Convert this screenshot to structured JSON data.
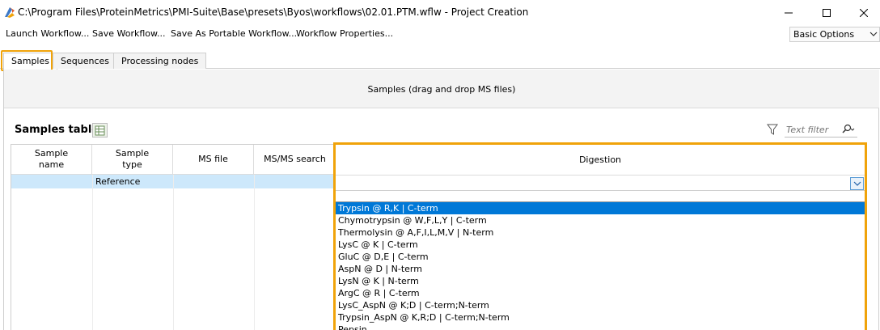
{
  "window": {
    "title": "C:\\Program Files\\ProteinMetrics\\PMI-Suite\\Base\\presets\\Byos\\workflows\\02.01.PTM.wflw - Project Creation"
  },
  "menu": {
    "items": [
      "Launch Workflow...",
      "Save Workflow...",
      "Save As Portable Workflow...",
      "Workflow Properties..."
    ],
    "options_value": "Basic Options"
  },
  "tabs": [
    "Samples",
    "Sequences",
    "Processing nodes"
  ],
  "dropzone": {
    "text": "Samples (drag and drop MS files)"
  },
  "samples_table": {
    "title": "Samples table",
    "filter_placeholder": "Text filter",
    "columns": [
      "Sample\nname",
      "Sample\ntype",
      "MS file",
      "MS/MS search"
    ],
    "rows": [
      {
        "sample_type": "Reference"
      }
    ]
  },
  "digestion": {
    "header": "Digestion",
    "selected_index": 0,
    "options": [
      "Trypsin @ R,K | C-term",
      "Chymotrypsin @ W,F,L,Y | C-term",
      "Thermolysin @ A,F,I,L,M,V | N-term",
      "LysC @ K | C-term",
      "GluC @ D,E | C-term",
      "AspN @ D | N-term",
      "LysN @ K | N-term",
      "ArgC @ R | C-term",
      "LysC_AspN @ K;D | C-term;N-term",
      "Trypsin_AspN @ K,R;D | C-term;N-term",
      "Pepsin"
    ]
  },
  "colors": {
    "highlight": "#f0a30a",
    "selection": "#0078d7",
    "row_selected": "#cde8fb"
  }
}
